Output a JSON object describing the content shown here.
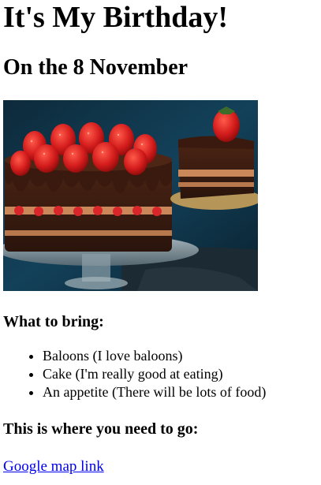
{
  "page": {
    "title": "It's My Birthday!",
    "date_heading": "On the 8 November",
    "image": {
      "icon": "birthday-cake-photo",
      "description": "chocolate cake topped with strawberries"
    },
    "bring_heading": "What to bring:",
    "bring_items": [
      "Baloons (I love baloons)",
      "Cake (I'm really good at eating)",
      "An appetite (There will be lots of food)"
    ],
    "location_heading": "This is where you need to go:",
    "map_link_label": "Google map link"
  },
  "colors": {
    "link": "#0000ee",
    "text": "#000000",
    "background": "#ffffff"
  }
}
